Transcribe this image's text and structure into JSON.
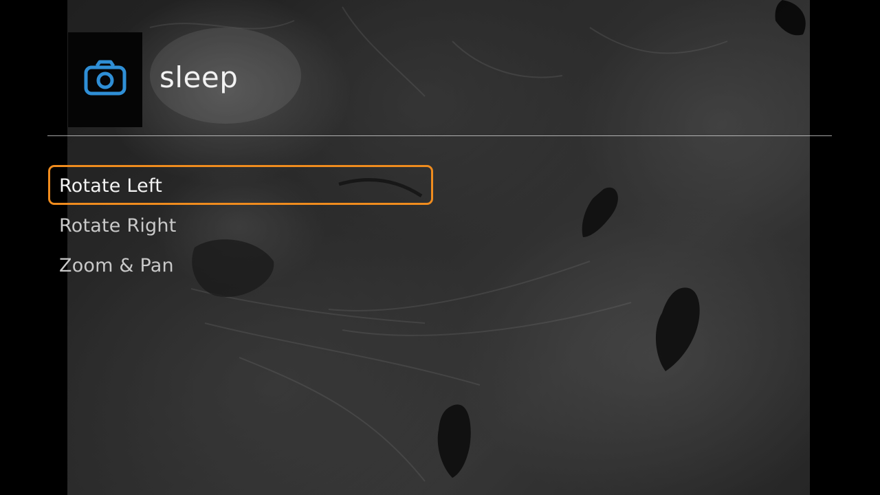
{
  "header": {
    "title": "sleep",
    "icon": "camera-icon",
    "icon_color": "#2f8fd6"
  },
  "menu": {
    "selected_index": 0,
    "selected_color": "#f08c1e",
    "items": [
      {
        "label": "Rotate Left"
      },
      {
        "label": "Rotate Right"
      },
      {
        "label": "Zoom & Pan"
      }
    ]
  }
}
